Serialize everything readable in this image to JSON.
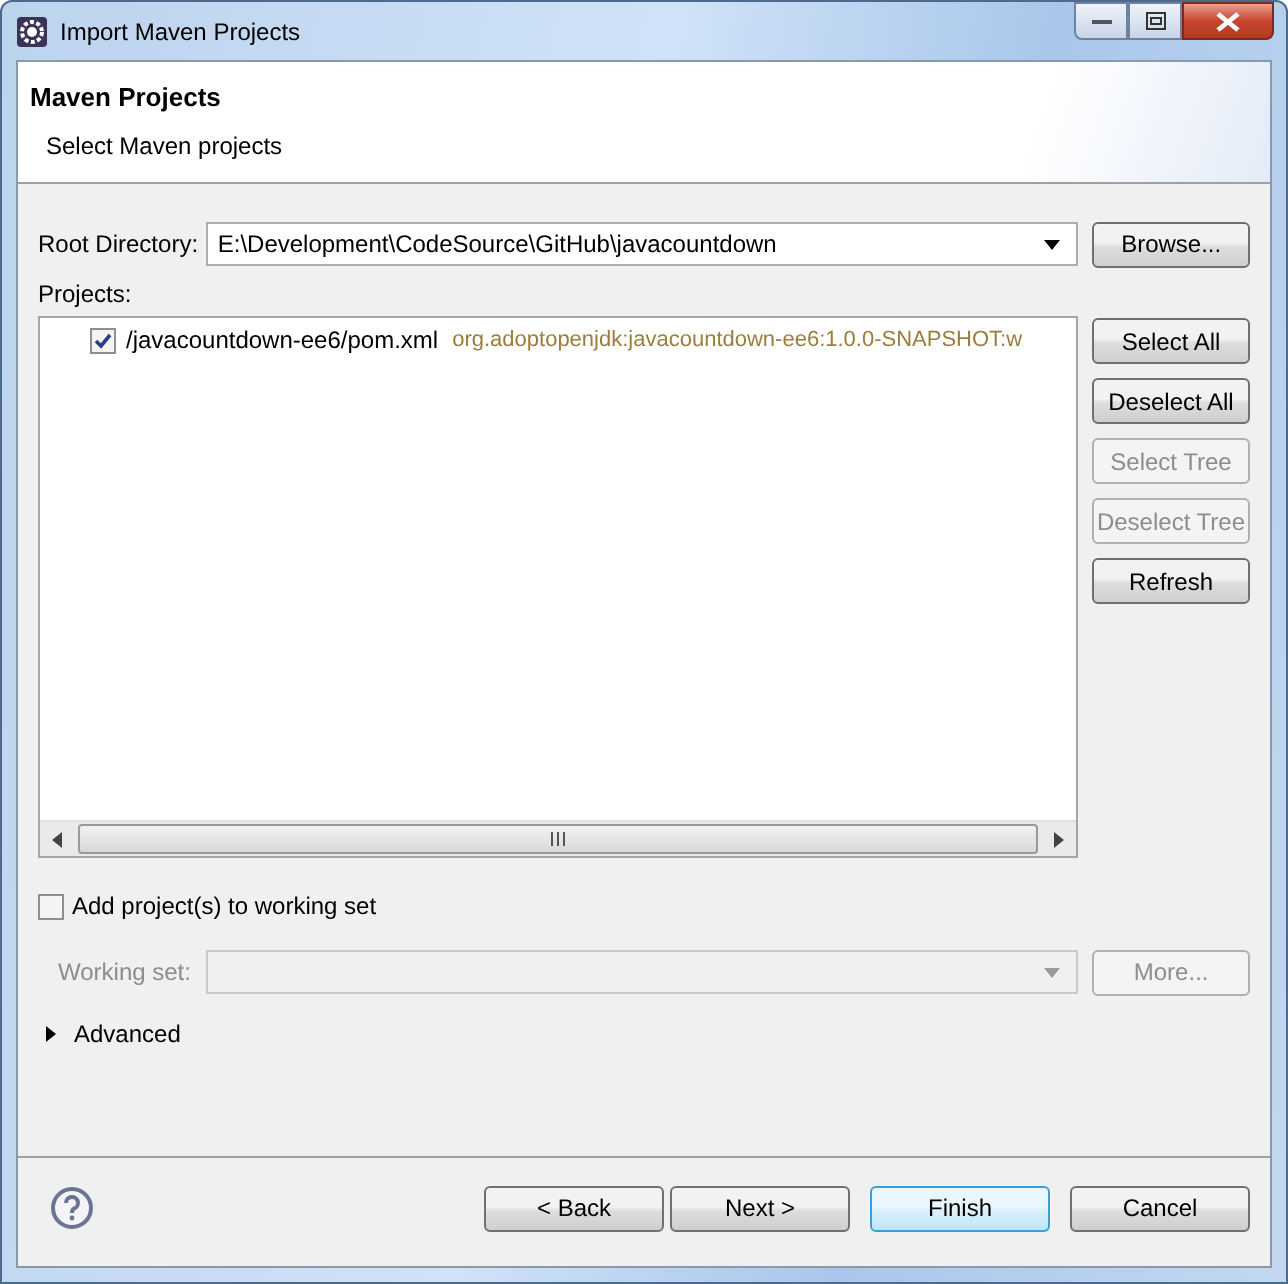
{
  "window": {
    "title": "Import Maven Projects"
  },
  "header": {
    "title": "Maven Projects",
    "subtitle": "Select Maven projects"
  },
  "root_directory": {
    "label": "Root Directory:",
    "value": "E:\\Development\\CodeSource\\GitHub\\javacountdown",
    "button": "Browse..."
  },
  "projects": {
    "label": "Projects:",
    "items": [
      {
        "path": "/javacountdown-ee6/pom.xml",
        "artifact": "org.adoptopenjdk:javacountdown-ee6:1.0.0-SNAPSHOT:w",
        "checked": true
      }
    ]
  },
  "side_buttons": [
    {
      "label": "Select All",
      "disabled": false
    },
    {
      "label": "Deselect All",
      "disabled": false
    },
    {
      "label": "Select Tree",
      "disabled": true
    },
    {
      "label": "Deselect Tree",
      "disabled": true
    },
    {
      "label": "Refresh",
      "disabled": false
    }
  ],
  "working_set_checkbox": {
    "label": "Add project(s) to working set",
    "checked": false
  },
  "working_set": {
    "label": "Working set:",
    "disabled": true,
    "button": "More..."
  },
  "advanced": {
    "label": "Advanced",
    "expanded": false
  },
  "footer_buttons": [
    {
      "label": "< Back",
      "default": false
    },
    {
      "label": "Next >",
      "default": false
    },
    {
      "label": "Finish",
      "default": true
    },
    {
      "label": "Cancel",
      "default": false
    }
  ]
}
